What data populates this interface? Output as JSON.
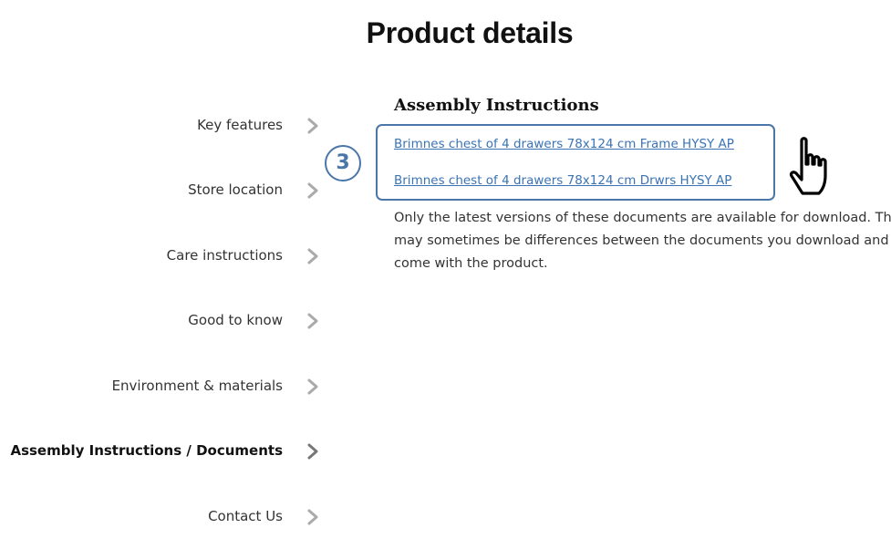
{
  "page": {
    "title": "Product details"
  },
  "sidebar": {
    "items": [
      {
        "label": "Key features",
        "active": false
      },
      {
        "label": "Store location",
        "active": false
      },
      {
        "label": "Care instructions",
        "active": false
      },
      {
        "label": "Good to know",
        "active": false
      },
      {
        "label": "Environment & materials",
        "active": false
      },
      {
        "label": "Assembly Instructions / Documents",
        "active": true
      },
      {
        "label": "Contact Us",
        "active": false
      }
    ],
    "chevron_icon": "chevron-right-icon",
    "chevron_color": "#aaaaaa",
    "chevron_active_color": "#777777"
  },
  "content": {
    "section_title": "Assembly Instructions",
    "links": [
      {
        "label": "Brimnes chest of 4 drawers 78x124 cm Frame HYSY AP"
      },
      {
        "label": "Brimnes chest of 4 drawers 78x124 cm Drwrs HYSY AP"
      }
    ],
    "note_lines": [
      "Only the latest versions of these documents are available for download. There",
      "may sometimes be differences between the documents you download and those that",
      "come with the product."
    ]
  },
  "annotation": {
    "step_number": "3",
    "accent_color": "#4a76a8",
    "cursor_icon": "hand-pointer-icon"
  }
}
